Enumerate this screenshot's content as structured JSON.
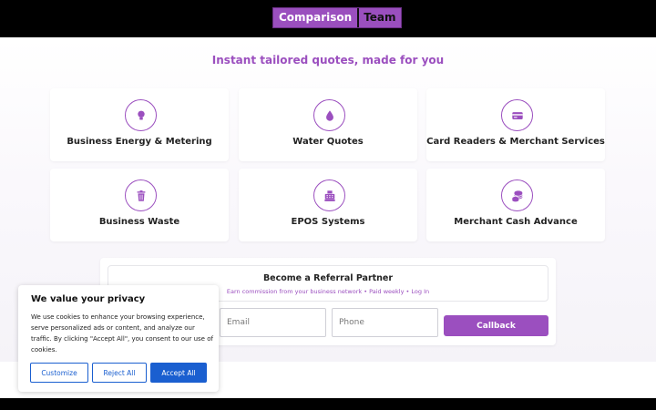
{
  "header": {
    "logo_part1": "Comparison",
    "logo_part2": "Team"
  },
  "tagline": "Instant tailored quotes, made for you",
  "services": [
    {
      "label": "Business Energy & Metering",
      "icon": "lightbulb-icon"
    },
    {
      "label": "Water Quotes",
      "icon": "water-drop-icon"
    },
    {
      "label": "Card Readers & Merchant Services",
      "icon": "credit-card-icon"
    },
    {
      "label": "Business Waste",
      "icon": "trash-bin-icon"
    },
    {
      "label": "EPOS Systems",
      "icon": "cash-register-icon"
    },
    {
      "label": "Merchant Cash Advance",
      "icon": "coins-icon"
    }
  ],
  "referral": {
    "title": "Become a Referral Partner",
    "subtitle": "Earn commission from your business network • Paid weekly • Log In"
  },
  "form": {
    "email_placeholder": "Email",
    "phone_placeholder": "Phone",
    "callback_label": "Callback"
  },
  "cookie": {
    "title": "We value your privacy",
    "text": "We use cookies to enhance your browsing experience, serve personalized ads or content, and analyze our traffic. By clicking \"Accept All\", you consent to our use of cookies.",
    "customize_label": "Customize",
    "reject_label": "Reject All",
    "accept_label": "Accept All"
  },
  "colors": {
    "accent": "#9b4fbf",
    "primary_button": "#1a5fd0",
    "topbar": "#000000"
  }
}
